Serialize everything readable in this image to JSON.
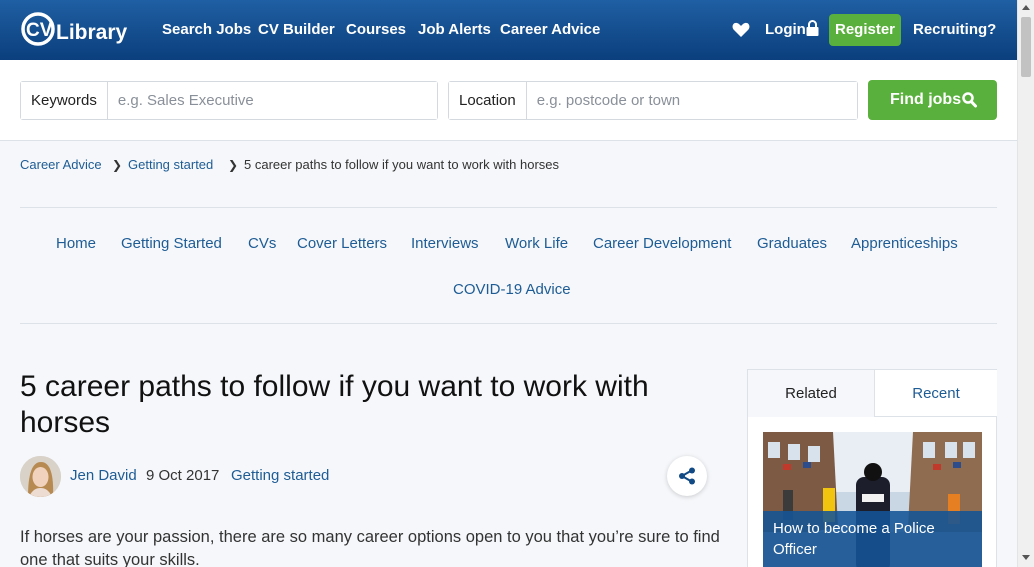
{
  "header": {
    "logo_text": "CV Library",
    "nav": [
      "Search Jobs",
      "CV Builder",
      "Courses",
      "Job Alerts",
      "Career Advice"
    ],
    "login": "Login",
    "register": "Register",
    "recruiting": "Recruiting?"
  },
  "search": {
    "keywords_label": "Keywords",
    "keywords_placeholder": "e.g. Sales Executive",
    "location_label": "Location",
    "location_placeholder": "e.g. postcode or town",
    "button": "Find jobs"
  },
  "breadcrumb": [
    "Career Advice",
    "Getting started",
    "5 career paths to follow if you want to work with horses"
  ],
  "categories": [
    "Home",
    "Getting Started",
    "CVs",
    "Cover Letters",
    "Interviews",
    "Work Life",
    "Career Development",
    "Graduates",
    "Apprenticeships",
    "COVID-19 Advice"
  ],
  "article": {
    "title": "5 career paths to follow if you want to work with horses",
    "author": "Jen David",
    "date": "9 Oct 2017",
    "category": "Getting started",
    "intro": "If horses are your passion, there are so many career options open to you that you’re sure to find one that suits your skills."
  },
  "sidebar": {
    "tabs": [
      "Related",
      "Recent"
    ],
    "card_title": "How to become a Police Officer"
  },
  "colors": {
    "brand_blue": "#0b3f7d",
    "accent_green": "#5ab03c",
    "link_blue": "#1e5c95"
  }
}
